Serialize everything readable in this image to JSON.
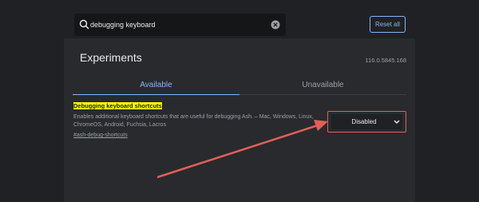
{
  "search": {
    "value": "debugging keyboard",
    "icon": "search-icon",
    "clear_icon": "clear-icon"
  },
  "header": {
    "reset_label": "Reset all"
  },
  "page": {
    "title": "Experiments",
    "version": "116.0.5845.168"
  },
  "tabs": [
    {
      "label": "Available",
      "selected": true
    },
    {
      "label": "Unavailable",
      "selected": false
    }
  ],
  "experiment": {
    "name_highlight": "Debugging keyboard",
    "name_rest": " shortcuts",
    "description": "Enables additional keyboard shortcuts that are useful for debugging Ash. – Mac, Windows, Linux, ChromeOS, Android, Fuchsia, Lacros",
    "link": "#ash-debug-shortcuts",
    "state": "Disabled"
  },
  "colors": {
    "background": "#202124",
    "panel": "#292a2d",
    "accent": "#8ab4f8",
    "highlight": "#ffff00",
    "annotation": "#e0605a"
  }
}
